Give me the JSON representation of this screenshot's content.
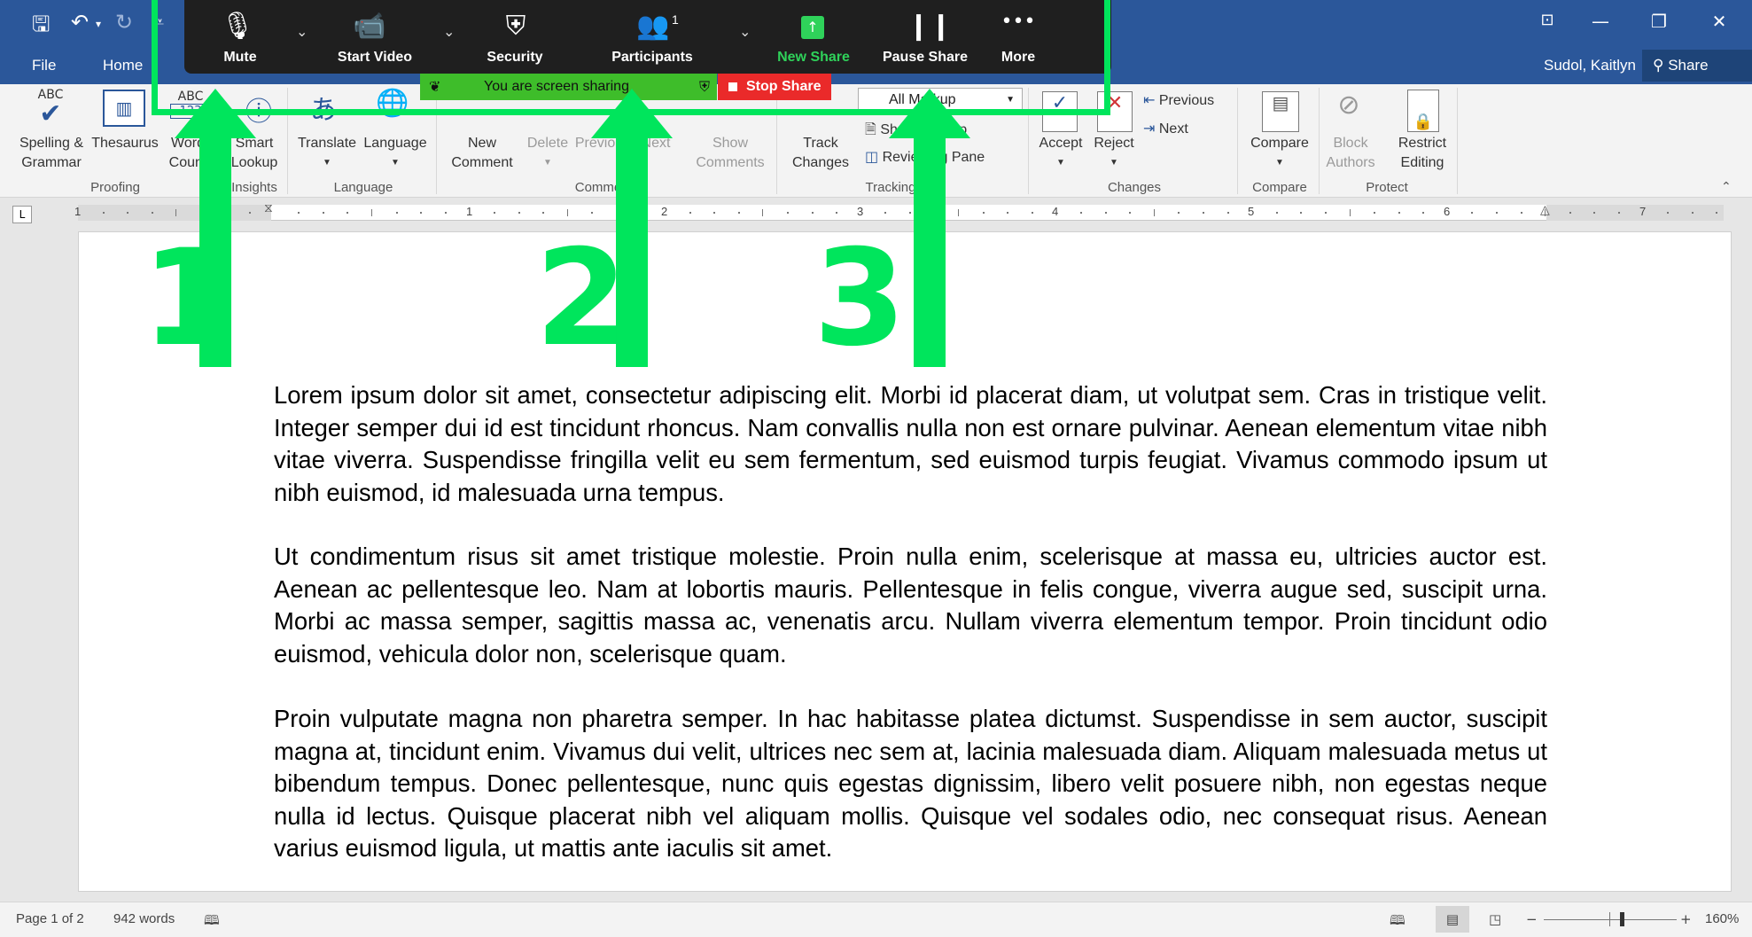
{
  "window": {
    "user_name": "Sudol, Kaitlyn",
    "share_label": "Share",
    "tabs": [
      "File",
      "Home"
    ]
  },
  "zoom_toolbar": {
    "items": [
      {
        "label": "Mute",
        "icon": "microphone-icon"
      },
      {
        "label": "Start Video",
        "icon": "video-off-icon"
      },
      {
        "label": "Security",
        "icon": "shield-icon"
      },
      {
        "label": "Participants",
        "icon": "participants-icon",
        "count": "1"
      },
      {
        "label": "New Share",
        "icon": "new-share-icon"
      },
      {
        "label": "Pause Share",
        "icon": "pause-icon"
      },
      {
        "label": "More",
        "icon": "more-icon"
      }
    ],
    "sharing_banner": "You are screen sharing",
    "stop_share": "Stop Share",
    "new_share_color": "#2fd25a",
    "stop_share_color": "#ea2a2a",
    "banner_color": "#3ebd2a"
  },
  "ribbon": {
    "proofing": {
      "spelling_1": "Spelling &",
      "spelling_2": "Grammar",
      "thesaurus": "Thesaurus",
      "word_count_1": "Word",
      "word_count_2": "Count",
      "group": "Proofing"
    },
    "insights": {
      "smart_lookup_1": "Smart",
      "smart_lookup_2": "Lookup",
      "group": "Insights"
    },
    "language": {
      "translate": "Translate",
      "language": "Language",
      "group": "Language"
    },
    "comments": {
      "new_1": "New",
      "new_2": "Comment",
      "delete": "Delete",
      "previous": "Previous",
      "next": "Next",
      "show_1": "Show",
      "show_2": "Comments",
      "group": "Comments"
    },
    "tracking": {
      "track_1": "Track",
      "track_2": "Changes",
      "markup_select": "All Markup",
      "show_markup": "Show Markup",
      "reviewing_pane": "Reviewing Pane",
      "group": "Tracking"
    },
    "changes": {
      "accept": "Accept",
      "reject": "Reject",
      "previous": "Previous",
      "next": "Next",
      "group": "Changes"
    },
    "compare": {
      "compare": "Compare",
      "group": "Compare"
    },
    "protect": {
      "block_1": "Block",
      "block_2": "Authors",
      "restrict_1": "Restrict",
      "restrict_2": "Editing",
      "group": "Protect"
    }
  },
  "ruler": {
    "numbers": [
      "1",
      "1",
      "2",
      "3",
      "4",
      "5",
      "6",
      "7"
    ]
  },
  "annotation": {
    "numbers": [
      "1",
      "2",
      "3"
    ],
    "color": "#00e55c"
  },
  "document": {
    "paragraphs": [
      "Lorem ipsum dolor sit amet, consectetur adipiscing elit. Morbi id placerat diam, ut volutpat sem. Cras in tristique velit. Integer semper dui id est tincidunt rhoncus. Nam convallis nulla non est ornare pulvinar. Aenean elementum vitae nibh vitae viverra. Suspendisse fringilla velit eu sem fermentum, sed euismod turpis feugiat. Vivamus commodo ipsum ut nibh euismod, id malesuada urna tempus.",
      "Ut condimentum risus sit amet tristique molestie. Proin nulla enim, scelerisque at massa eu, ultricies auctor est. Aenean ac pellentesque leo. Nam at lobortis mauris. Pellentesque in felis congue, viverra augue sed, suscipit urna. Morbi ac massa semper, sagittis massa ac, venenatis arcu. Nullam viverra elementum tempor. Proin tincidunt odio euismod, vehicula dolor non, scelerisque quam.",
      "Proin vulputate magna non pharetra semper. In hac habitasse platea dictumst. Suspendisse in sem auctor, suscipit magna at, tincidunt enim. Vivamus dui velit, ultrices nec sem at, lacinia malesuada diam. Aliquam malesuada metus ut bibendum tempus. Donec pellentesque, nunc quis egestas dignissim, libero velit posuere nibh, non egestas neque nulla id lectus. Quisque placerat nibh vel aliquam mollis. Quisque vel sodales odio, nec consequat risus. Aenean varius euismod ligula, ut mattis ante iaculis sit amet."
    ]
  },
  "status_bar": {
    "page": "Page 1 of 2",
    "words": "942 words",
    "zoom": "160%"
  }
}
